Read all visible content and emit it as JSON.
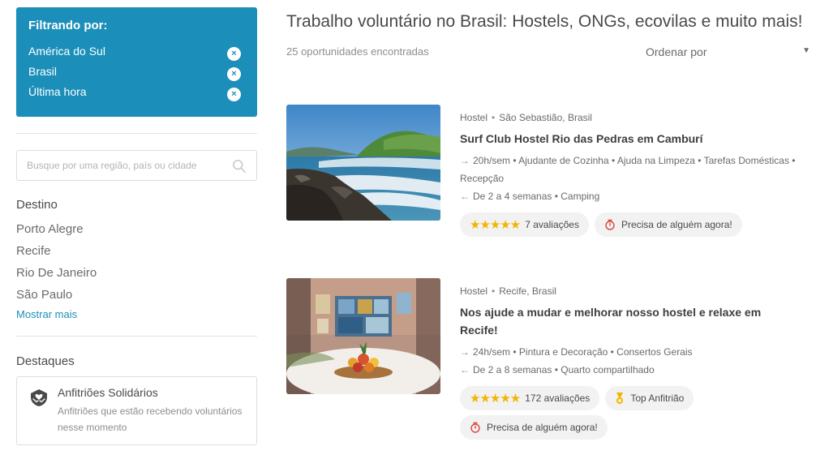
{
  "filters": {
    "title": "Filtrando por:",
    "items": [
      {
        "label": "América do Sul",
        "remove": "×"
      },
      {
        "label": "Brasil",
        "remove": "×"
      },
      {
        "label": "Última hora",
        "remove": "×"
      }
    ]
  },
  "search": {
    "placeholder": "Busque por uma região, país ou cidade",
    "icon": "search-icon"
  },
  "destino": {
    "title": "Destino",
    "items": [
      "Porto Alegre",
      "Recife",
      "Rio De Janeiro",
      "São Paulo"
    ],
    "more": "Mostrar mais"
  },
  "destaques": {
    "title": "Destaques",
    "card": {
      "icon": "handshake-heart-icon",
      "title": "Anfitriões Solidários",
      "desc": "Anfitriões que estão recebendo voluntários nesse momento"
    }
  },
  "main": {
    "title": "Trabalho voluntário no Brasil: Hostels, ONGs, ecovilas e muito mais!",
    "count": "25 oportunidades encontradas",
    "sort_label": "Ordenar por",
    "sort_caret": "▼"
  },
  "listings": [
    {
      "type": "Hostel",
      "location": "São Sebastião, Brasil",
      "title": "Surf Club Hostel Rio das Pedras em Camburí",
      "tasks": "20h/sem • Ajudante de Cozinha • Ajuda na Limpeza • Tarefas Domésticas • Recepção",
      "stay": "De 2 a 4 semanas • Camping",
      "rating_stars": "★★★★★",
      "reviews": "7 avaliações",
      "urgent": "Precisa de alguém agora!",
      "image": "coast-photo"
    },
    {
      "type": "Hostel",
      "location": "Recife, Brasil",
      "title": "Nos ajude a mudar e melhorar nosso hostel e relaxe em Recife!",
      "tasks": "24h/sem • Pintura e Decoração • Consertos Gerais",
      "stay": "De 2 a 8 semanas • Quarto compartilhado",
      "rating_stars": "★★★★★",
      "reviews": "172 avaliações",
      "badge": "Top Anfitrião",
      "urgent": "Precisa de alguém agora!",
      "image": "fruit-bowl-photo"
    }
  ],
  "colors": {
    "accent": "#1b8fb9",
    "star": "#f4b400",
    "urgent": "#d9453b",
    "pill_bg": "#f2f2f2"
  }
}
